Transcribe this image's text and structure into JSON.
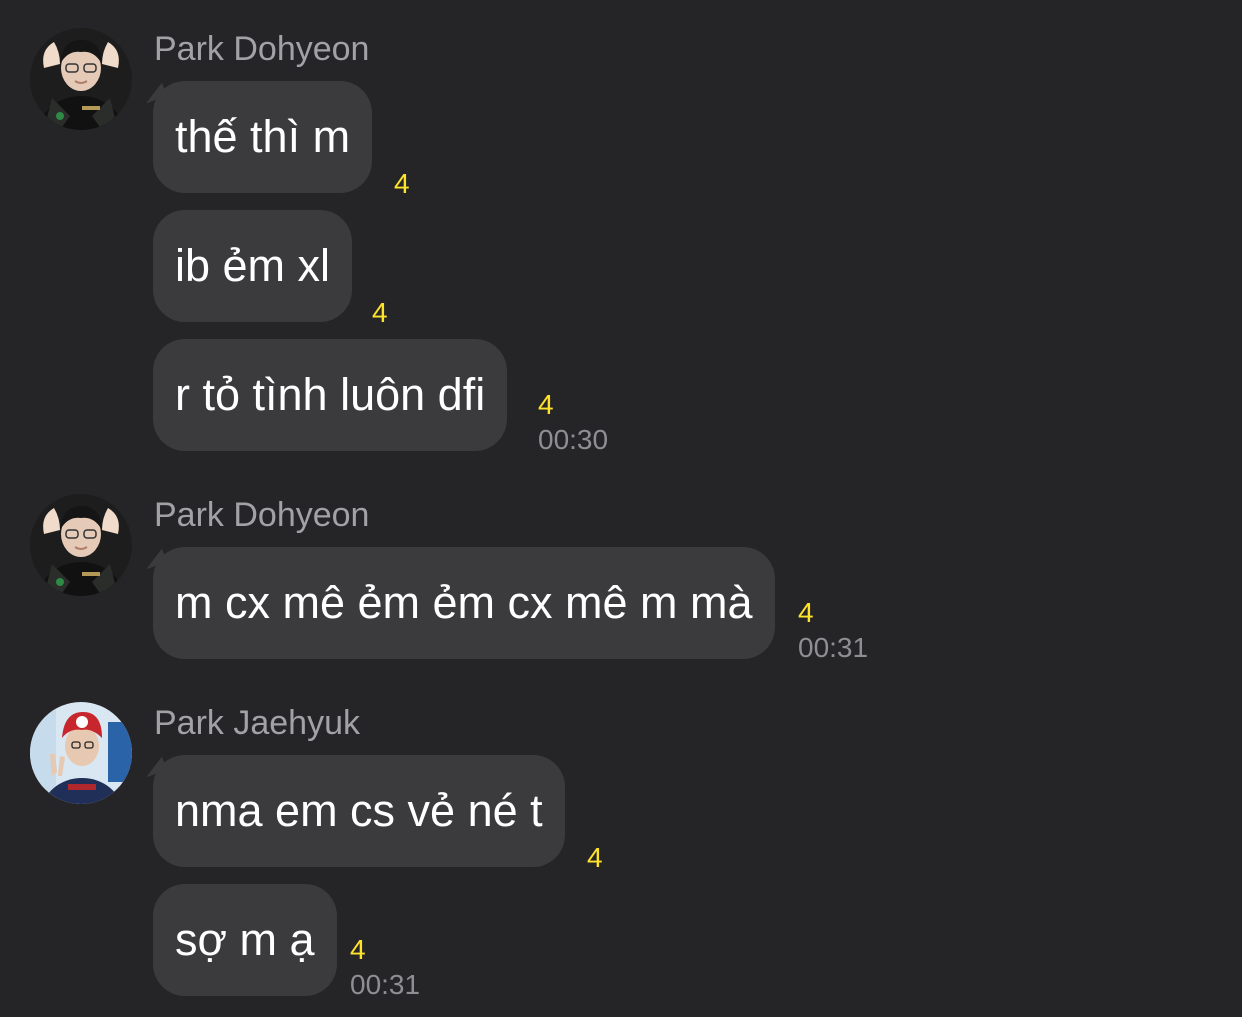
{
  "groups": [
    {
      "sender": "Park Dohyeon",
      "avatar_icon": "user-photo-icon",
      "messages": [
        {
          "text": "thế thì m",
          "count": "4"
        },
        {
          "text": "ib ẻm xl",
          "count": "4"
        },
        {
          "text": "r tỏ tình luôn dfi",
          "count": "4",
          "time": "00:30"
        }
      ]
    },
    {
      "sender": "Park Dohyeon",
      "avatar_icon": "user-photo-icon",
      "messages": [
        {
          "text": "m cx mê ẻm ẻm cx mê m mà",
          "count": "4",
          "time": "00:31"
        }
      ]
    },
    {
      "sender": "Park Jaehyuk",
      "avatar_icon": "user-photo-icon",
      "messages": [
        {
          "text": "nma em cs vẻ né t",
          "count": "4"
        },
        {
          "text": "sợ m ạ",
          "count": "4",
          "time": "00:31"
        }
      ]
    }
  ],
  "colors": {
    "background": "#252527",
    "bubble": "#3b3b3d",
    "unread_count": "#ffe32a",
    "sender_name": "#a1a1a6",
    "timestamp": "#8e8e93"
  }
}
